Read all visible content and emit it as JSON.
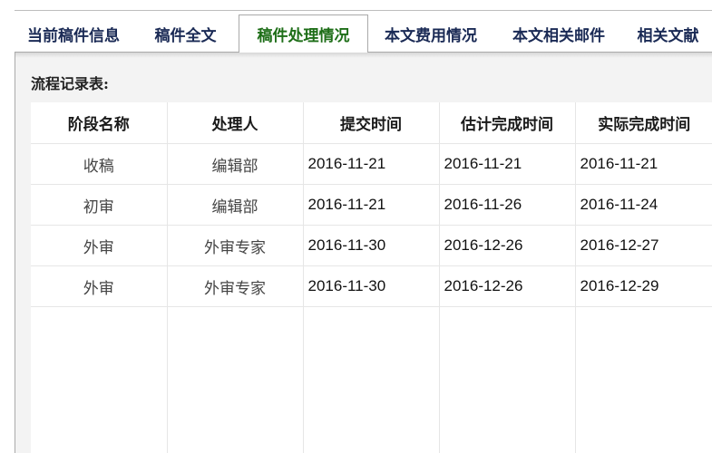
{
  "tabs": [
    {
      "label": "当前稿件信息",
      "active": false
    },
    {
      "label": "稿件全文",
      "active": false
    },
    {
      "label": "稿件处理情况",
      "active": true
    },
    {
      "label": "本文费用情况",
      "active": false
    },
    {
      "label": "本文相关邮件",
      "active": false
    },
    {
      "label": "相关文献",
      "active": false
    }
  ],
  "section_title": "流程记录表:",
  "table": {
    "headers": [
      "阶段名称",
      "处理人",
      "提交时间",
      "估计完成时间",
      "实际完成时间"
    ],
    "rows": [
      [
        "收稿",
        "编辑部",
        "2016-11-21",
        "2016-11-21",
        "2016-11-21"
      ],
      [
        "初审",
        "编辑部",
        "2016-11-21",
        "2016-11-26",
        "2016-11-24"
      ],
      [
        "外审",
        "外审专家",
        "2016-11-30",
        "2016-12-26",
        "2016-12-27"
      ],
      [
        "外审",
        "外审专家",
        "2016-11-30",
        "2016-12-26",
        "2016-12-29"
      ]
    ]
  },
  "colors": {
    "active_tab_text": "#1e6e18",
    "tab_text": "#1a2a55",
    "panel_background": "#f3f3f3",
    "table_background": "#ffffff",
    "grid_line": "#e6e6e6"
  }
}
